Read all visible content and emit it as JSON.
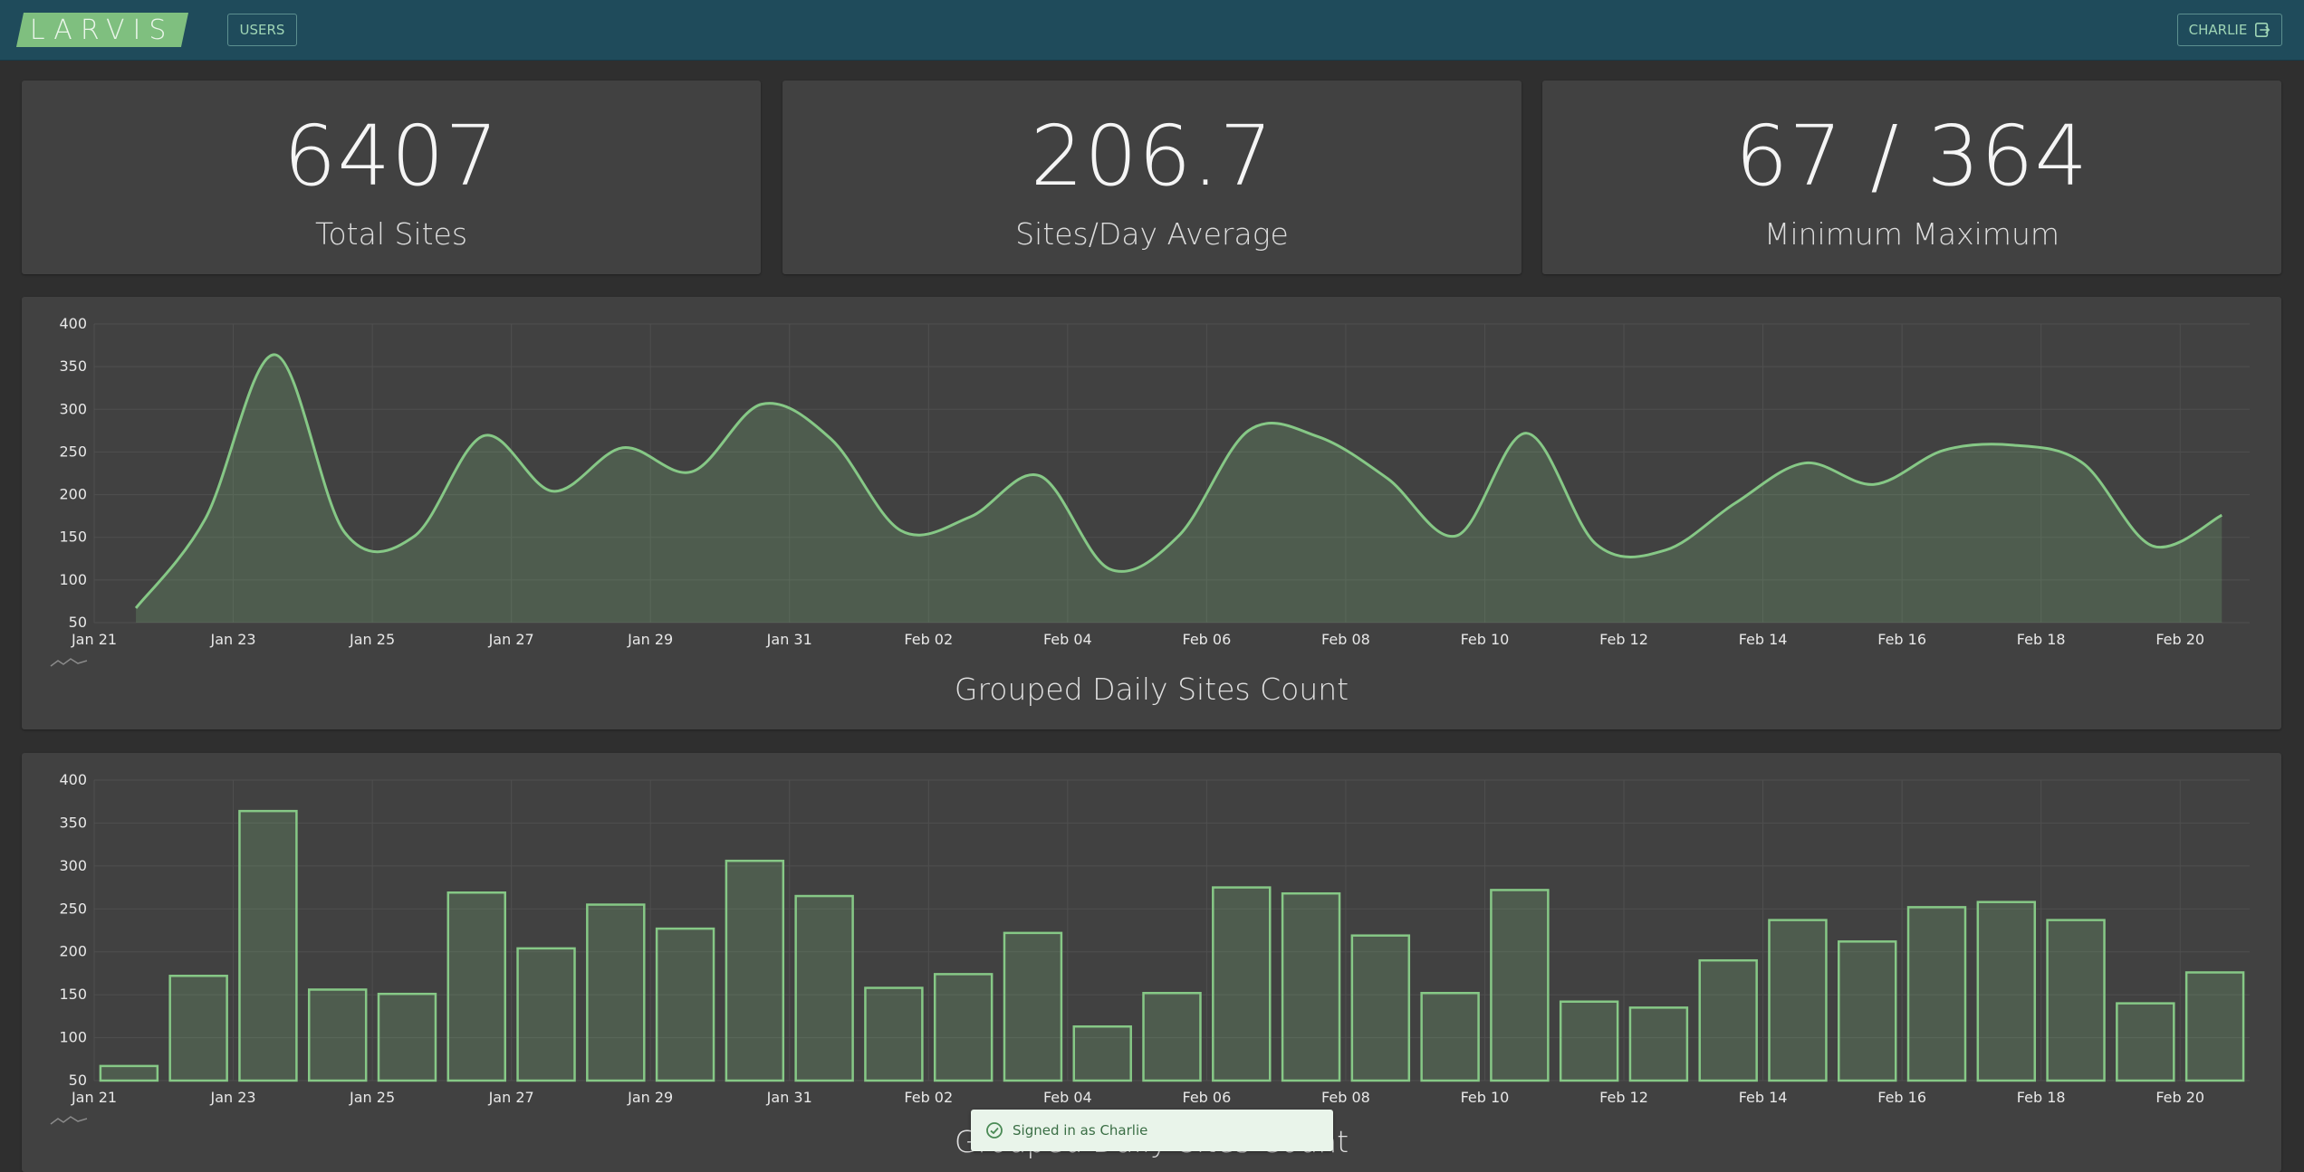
{
  "navbar": {
    "logo": "LARVIS",
    "users_label": "USERS",
    "user_label": "CHARLIE",
    "logout_icon": "logout-icon"
  },
  "stats": [
    {
      "value": "6407",
      "label": "Total Sites"
    },
    {
      "value": "206.7",
      "label": "Sites/Day Average"
    },
    {
      "value": "67 / 364",
      "label": "Minimum Maximum"
    }
  ],
  "charts": {
    "area_title": "Grouped Daily Sites Count",
    "bar_title": "Grouped Daily Sites Count"
  },
  "toast": {
    "message": "Signed in as Charlie",
    "icon": "check-circle-icon"
  },
  "colors": {
    "accent": "#7fbf7f",
    "navbar": "#1f4b5b",
    "card": "#414141",
    "background": "#2f2f2f"
  },
  "chart_data": [
    {
      "type": "area",
      "title": "Grouped Daily Sites Count",
      "xlabel": "",
      "ylabel": "",
      "ylim": [
        50,
        400
      ],
      "yticks": [
        50,
        100,
        150,
        200,
        250,
        300,
        350,
        400
      ],
      "tick_labels": [
        "Jan 21",
        "Jan 23",
        "Jan 25",
        "Jan 27",
        "Jan 29",
        "Jan 31",
        "Feb 02",
        "Feb 04",
        "Feb 06",
        "Feb 08",
        "Feb 10",
        "Feb 12",
        "Feb 14",
        "Feb 16",
        "Feb 18",
        "Feb 20"
      ],
      "grid": true,
      "x": [
        "Jan 21",
        "Jan 22",
        "Jan 23",
        "Jan 24",
        "Jan 25",
        "Jan 26",
        "Jan 27",
        "Jan 28",
        "Jan 29",
        "Jan 30",
        "Jan 31",
        "Feb 01",
        "Feb 02",
        "Feb 03",
        "Feb 04",
        "Feb 05",
        "Feb 06",
        "Feb 07",
        "Feb 08",
        "Feb 09",
        "Feb 10",
        "Feb 11",
        "Feb 12",
        "Feb 13",
        "Feb 14",
        "Feb 15",
        "Feb 16",
        "Feb 17",
        "Feb 18",
        "Feb 19",
        "Feb 20"
      ],
      "values": [
        67,
        172,
        364,
        156,
        151,
        269,
        204,
        255,
        227,
        306,
        265,
        158,
        174,
        222,
        113,
        152,
        275,
        268,
        219,
        152,
        272,
        142,
        135,
        190,
        237,
        212,
        252,
        258,
        237,
        140,
        176
      ]
    },
    {
      "type": "bar",
      "title": "Grouped Daily Sites Count",
      "xlabel": "",
      "ylabel": "",
      "ylim": [
        50,
        400
      ],
      "yticks": [
        50,
        100,
        150,
        200,
        250,
        300,
        350,
        400
      ],
      "tick_labels": [
        "Jan 21",
        "Jan 23",
        "Jan 25",
        "Jan 27",
        "Jan 29",
        "Jan 31",
        "Feb 02",
        "Feb 04",
        "Feb 06",
        "Feb 08",
        "Feb 10",
        "Feb 12",
        "Feb 14",
        "Feb 16",
        "Feb 18",
        "Feb 20"
      ],
      "grid": true,
      "x": [
        "Jan 21",
        "Jan 22",
        "Jan 23",
        "Jan 24",
        "Jan 25",
        "Jan 26",
        "Jan 27",
        "Jan 28",
        "Jan 29",
        "Jan 30",
        "Jan 31",
        "Feb 01",
        "Feb 02",
        "Feb 03",
        "Feb 04",
        "Feb 05",
        "Feb 06",
        "Feb 07",
        "Feb 08",
        "Feb 09",
        "Feb 10",
        "Feb 11",
        "Feb 12",
        "Feb 13",
        "Feb 14",
        "Feb 15",
        "Feb 16",
        "Feb 17",
        "Feb 18",
        "Feb 19",
        "Feb 20"
      ],
      "values": [
        67,
        172,
        364,
        156,
        151,
        269,
        204,
        255,
        227,
        306,
        265,
        158,
        174,
        222,
        113,
        152,
        275,
        268,
        219,
        152,
        272,
        142,
        135,
        190,
        237,
        212,
        252,
        258,
        237,
        140,
        176
      ]
    }
  ]
}
